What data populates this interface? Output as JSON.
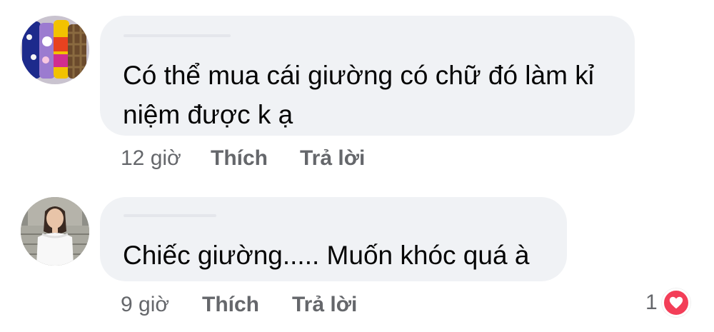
{
  "comments": [
    {
      "avatar_icon": "avatar-fabric-rolls",
      "text": "Có thể mua cái giường có chữ đó làm kỉ niệm được k ạ",
      "line1": "Có thể mua cái giường có chữ đó làm kỉ",
      "line2": "niệm được k ạ",
      "time": "12 giờ",
      "like_label": "Thích",
      "reply_label": "Trả lời"
    },
    {
      "avatar_icon": "avatar-woman-photo",
      "text": "Chiếc giường..... Muốn khóc quá à",
      "time": "9 giờ",
      "like_label": "Thích",
      "reply_label": "Trả lời",
      "reaction_count": "1",
      "reaction_icon": "heart-icon",
      "reaction_color": "#f33e58"
    }
  ],
  "colors": {
    "bubble_bg": "#f0f2f5",
    "text": "#050505",
    "meta": "#65676b"
  }
}
